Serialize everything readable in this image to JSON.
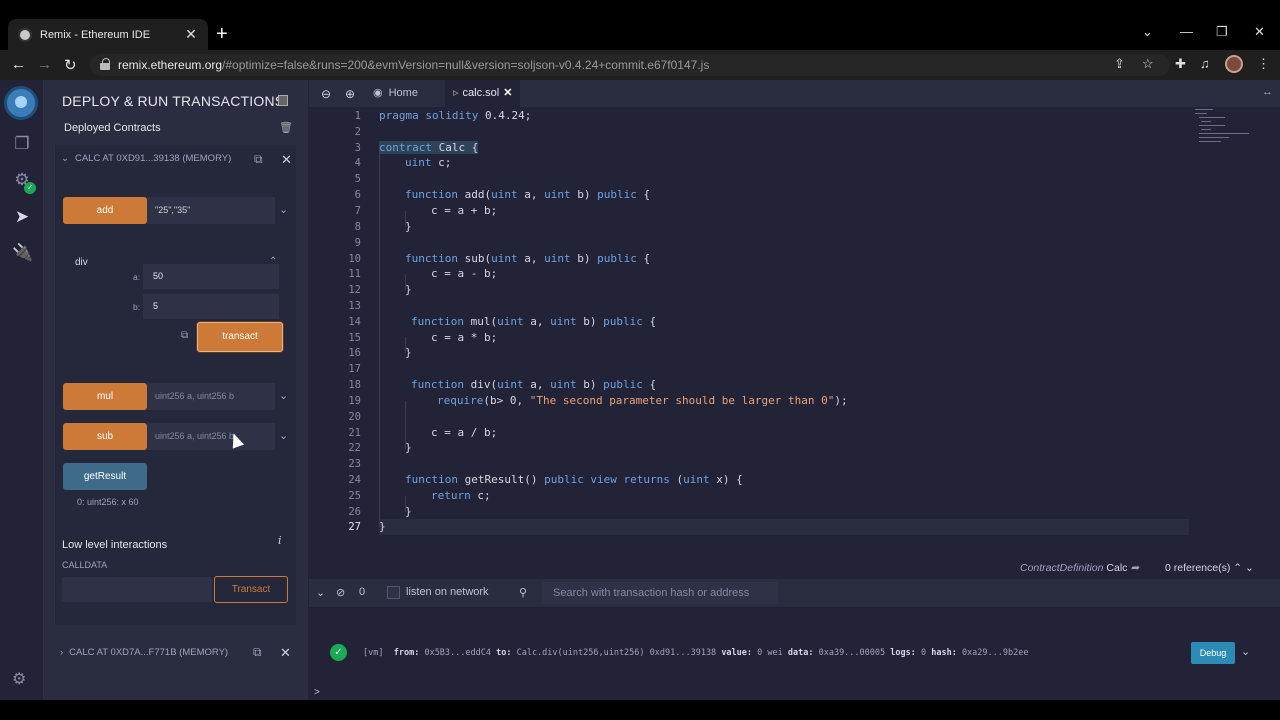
{
  "browser": {
    "tab_title": "Remix - Ethereum IDE",
    "new_tab": "+",
    "tab_close": "✕",
    "url_host": "remix.ethereum.org",
    "url_rest": "/#optimize=false&runs=200&evmVersion=null&version=soljson-v0.4.24+commit.e67f0147.js"
  },
  "sidepanel": {
    "title": "DEPLOY & RUN TRANSACTIONS",
    "deployed_label": "Deployed Contracts",
    "contract1": {
      "header": "CALC AT 0XD91...39138 (MEMORY)",
      "add": {
        "label": "add",
        "value": "\"25\",\"35\""
      },
      "div": {
        "label": "div",
        "param_a_label": "a:",
        "param_a_value": "50",
        "param_b_label": "b:",
        "param_b_value": "5",
        "transact": "transact"
      },
      "mul": {
        "label": "mul",
        "placeholder": "uint256 a, uint256 b"
      },
      "sub": {
        "label": "sub",
        "placeholder": "uint256 a, uint256 b"
      },
      "getResult": {
        "label": "getResult",
        "result": "0: uint256: x 60"
      }
    },
    "low_level": {
      "title": "Low level interactions",
      "calldata_label": "CALLDATA",
      "transact": "Transact"
    },
    "contract2": {
      "header": "CALC AT 0XD7A...F771B (MEMORY)"
    }
  },
  "editor": {
    "tabs": [
      {
        "label": "Home"
      },
      {
        "label": "calc.sol"
      }
    ],
    "line_numbers": [
      "1",
      "2",
      "3",
      "4",
      "5",
      "6",
      "7",
      "8",
      "9",
      "10",
      "11",
      "12",
      "13",
      "14",
      "15",
      "16",
      "17",
      "18",
      "19",
      "20",
      "21",
      "22",
      "23",
      "24",
      "25",
      "26",
      "27"
    ],
    "code": {
      "l1_kw": "pragma solidity",
      "l1_rest": " 0.4.24;",
      "l3_kw": "contract",
      "l3_rest": " Calc {",
      "l4_ty": "uint",
      "l4_rest": " c;",
      "l6_kw": "function",
      "l6_a": " add(",
      "l6_t1": "uint",
      "l6_b": " a, ",
      "l6_t2": "uint",
      "l6_c": " b) ",
      "l6_kw2": "public",
      "l6_d": " {",
      "l7": "c = a + b;",
      "l8": "}",
      "l10_kw": "function",
      "l10_a": " sub(",
      "l10_t1": "uint",
      "l10_b": " a, ",
      "l10_t2": "uint",
      "l10_c": " b) ",
      "l10_kw2": "public",
      "l10_d": " {",
      "l11": "c = a - b;",
      "l12": "}",
      "l14_kw": "function",
      "l14_a": " mul(",
      "l14_t1": "uint",
      "l14_b": " a, ",
      "l14_t2": "uint",
      "l14_c": " b) ",
      "l14_kw2": "public",
      "l14_d": " {",
      "l15": "c = a * b;",
      "l16": "}",
      "l18_kw": "function",
      "l18_a": " div(",
      "l18_t1": "uint",
      "l18_b": " a, ",
      "l18_t2": "uint",
      "l18_c": " b) ",
      "l18_kw2": "public",
      "l18_d": " {",
      "l19_kw": "require",
      "l19_a": "(b> 0, ",
      "l19_str": "\"The second parameter should be larger than 0\"",
      "l19_b": ");",
      "l21": "c = a / b;",
      "l22": "}",
      "l24_kw": "function",
      "l24_a": " getResult() ",
      "l24_kw2": "public view returns",
      "l24_b": " (",
      "l24_t": "uint",
      "l24_c": " x) {",
      "l25_kw": "return",
      "l25_rest": " c;",
      "l26": "}",
      "l27": "}"
    },
    "status_def": "ContractDefinition",
    "status_name": "Calc",
    "status_refs": "0 reference(s)"
  },
  "terminal": {
    "count": "0",
    "listen_label": "listen on network",
    "search_placeholder": "Search with transaction hash or address",
    "tx": {
      "vm": "[vm]",
      "from_label": "from:",
      "from": "0x5B3...eddC4",
      "to_label": "to:",
      "to": "Calc.div(uint256,uint256) 0xd91...39138",
      "value_label": "value:",
      "value": "0 wei",
      "data_label": "data:",
      "data": "0xa39...00005",
      "logs_label": "logs:",
      "logs": "0",
      "hash_label": "hash:",
      "hash": "0xa29...9b2ee"
    },
    "debug": "Debug",
    "prompt": ">"
  }
}
